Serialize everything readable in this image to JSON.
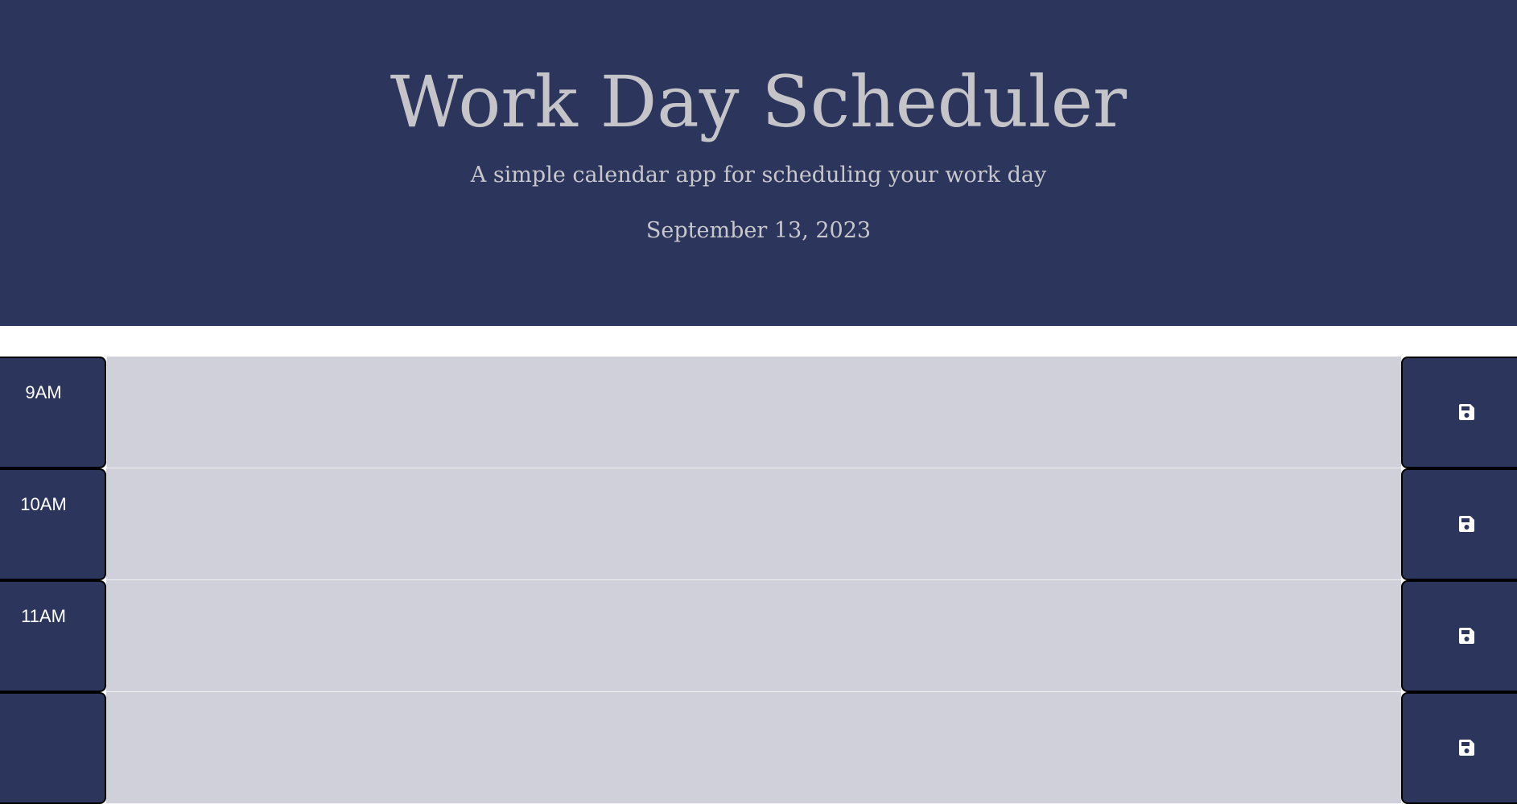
{
  "header": {
    "title": "Work Day Scheduler",
    "subtitle": "A simple calendar app for scheduling your work day",
    "date": "September 13, 2023"
  },
  "colors": {
    "header_bg": "#2c355b",
    "hour_block_bg": "#2c355b",
    "textarea_bg": "#d0d0da",
    "save_button_bg": "#2c355b"
  },
  "time_blocks": [
    {
      "hour": "9AM",
      "text": "",
      "save_icon": "floppy-disk-icon"
    },
    {
      "hour": "10AM",
      "text": "",
      "save_icon": "floppy-disk-icon"
    },
    {
      "hour": "11AM",
      "text": "",
      "save_icon": "floppy-disk-icon"
    },
    {
      "hour": "",
      "text": "",
      "save_icon": "floppy-disk-icon"
    }
  ]
}
